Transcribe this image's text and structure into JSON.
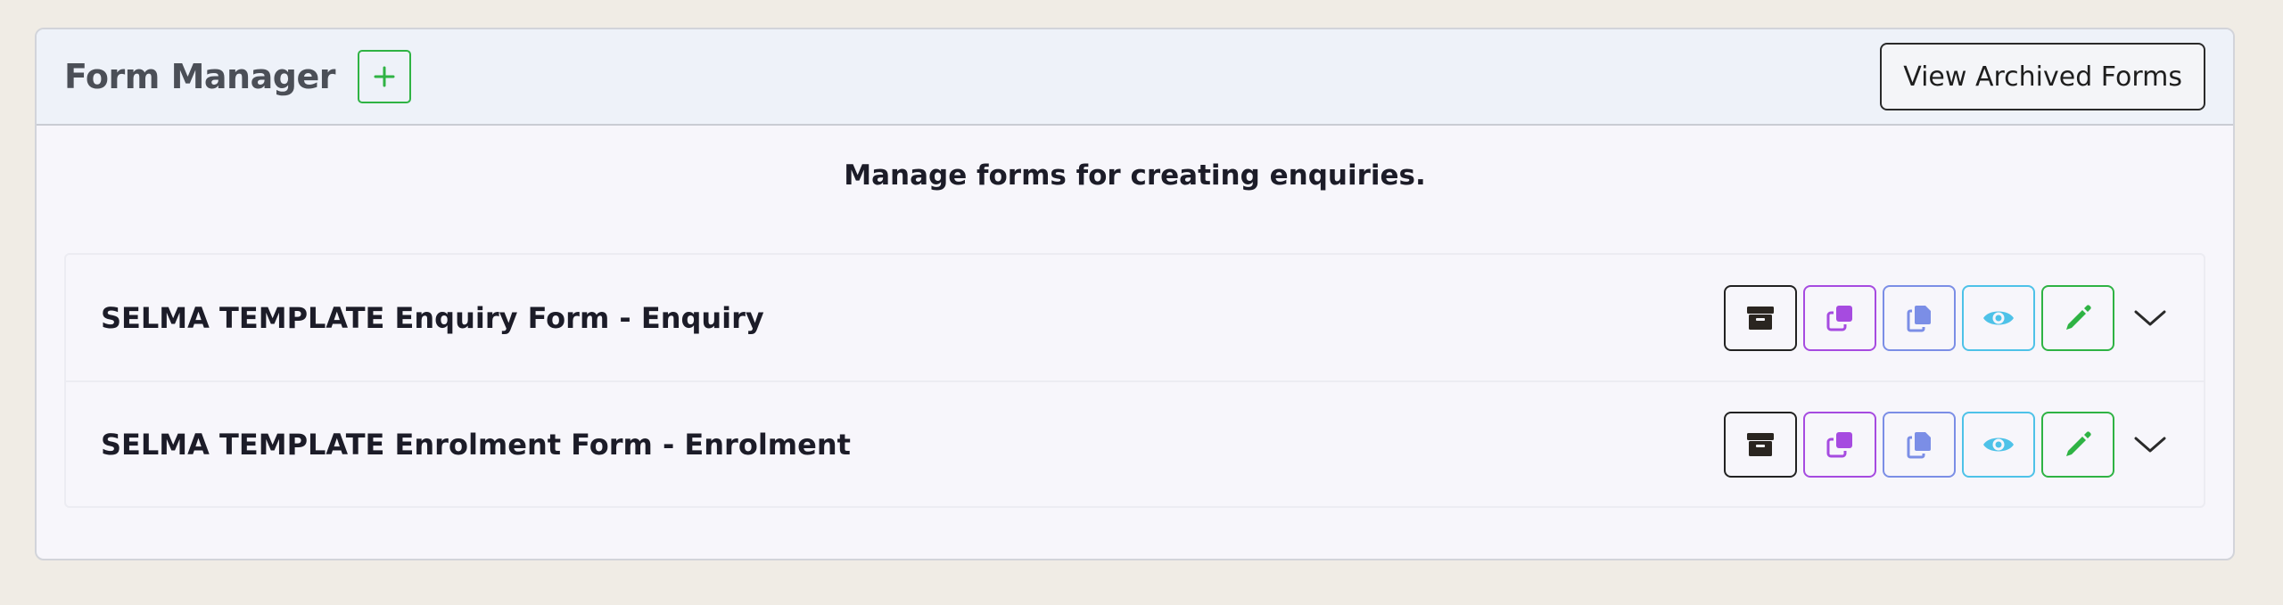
{
  "header": {
    "title": "Form Manager",
    "view_archived_label": "View Archived Forms"
  },
  "subtitle": "Manage forms for creating enquiries.",
  "forms": [
    {
      "title": "SELMA TEMPLATE Enquiry Form - Enquiry"
    },
    {
      "title": "SELMA TEMPLATE Enrolment Form - Enrolment"
    }
  ],
  "icons": {
    "add": "plus-icon",
    "archive": "archive-box-icon",
    "duplicate": "duplicate-icon",
    "copy": "copy-icon",
    "view": "eye-icon",
    "edit": "pencil-icon",
    "expand": "chevron-down-icon"
  },
  "colors": {
    "green": "#2fb344",
    "purple": "#a64be0",
    "periwinkle": "#7b8ee6",
    "cyan": "#4ec2e8",
    "dark": "#222222"
  }
}
